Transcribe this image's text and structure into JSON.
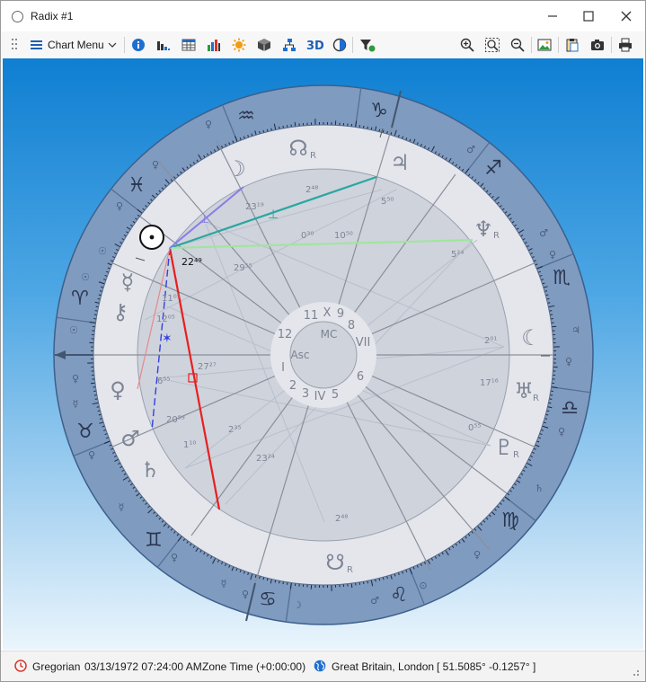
{
  "window": {
    "title": "Radix #1"
  },
  "toolbar": {
    "menu_label": "Chart Menu"
  },
  "chart": {
    "houses_inner": [
      "11",
      "X",
      "9",
      "8",
      "VII",
      "6",
      "5",
      "IV",
      "3",
      "2",
      "I",
      "12"
    ],
    "center_labels": {
      "mc": "MC",
      "asc": "Asc"
    },
    "degrees": {
      "sun": "22⁴⁹",
      "node": "2⁴⁸",
      "jupiter": "5⁵⁰",
      "neptune": "5²⁴",
      "moon_cusp": "23¹⁹",
      "moon_planet": "2⁰¹",
      "uranus": "17¹⁶",
      "pluto": "0⁵⁵",
      "cusp_2": "2⁴⁸",
      "mercury": "11⁰⁵",
      "chiron": "12⁰⁵",
      "venus": "6⁵⁵",
      "mars": "20⁵⁹",
      "saturn": "1¹⁰",
      "cusp_a": "29⁵⁵",
      "cusp_b": "0³⁰",
      "cusp_c": "10⁵⁰",
      "cusp_d": "27²⁷",
      "cusp_e": "2³⁵",
      "cusp_f": "23²⁴"
    },
    "planet_glyphs": {
      "sun": "☉",
      "moon": "☽",
      "mercury": "☿",
      "venus": "♀",
      "mars": "♂",
      "jupiter": "♃",
      "saturn": "♄",
      "uranus": "♅",
      "neptune": "♆",
      "pluto": "♇",
      "north_node": "☊",
      "south_node": "☋",
      "chiron": "⚷",
      "moon_waning": "☾"
    },
    "retrograde": "R",
    "zodiac": {
      "aries": "♈",
      "taurus": "♉",
      "gemini": "♊",
      "cancer": "♋",
      "leo": "♌",
      "virgo": "♍",
      "libra": "♎",
      "scorpio": "♏",
      "sagittarius": "♐",
      "capricorn": "♑",
      "aquarius": "♒",
      "pisces": "♓"
    }
  },
  "status": {
    "calendar": "Gregorian",
    "datetime": "03/13/1972 07:24:00 AM",
    "zone": "Zone Time (+0:00:00)",
    "location": "Great Britain, London",
    "coords": "[ 51.5085°  -0.1257° ]"
  },
  "colors": {
    "sky_top": "#0f7fd2",
    "ring_outer": "#7f9bbf",
    "ring_light": "#e4e6ec",
    "inner_fill": "#cfd3dc",
    "aspect_red": "#e81f1f",
    "aspect_teal": "#2aa7a0",
    "aspect_green": "#9de69a",
    "aspect_blue": "#3240e0"
  }
}
